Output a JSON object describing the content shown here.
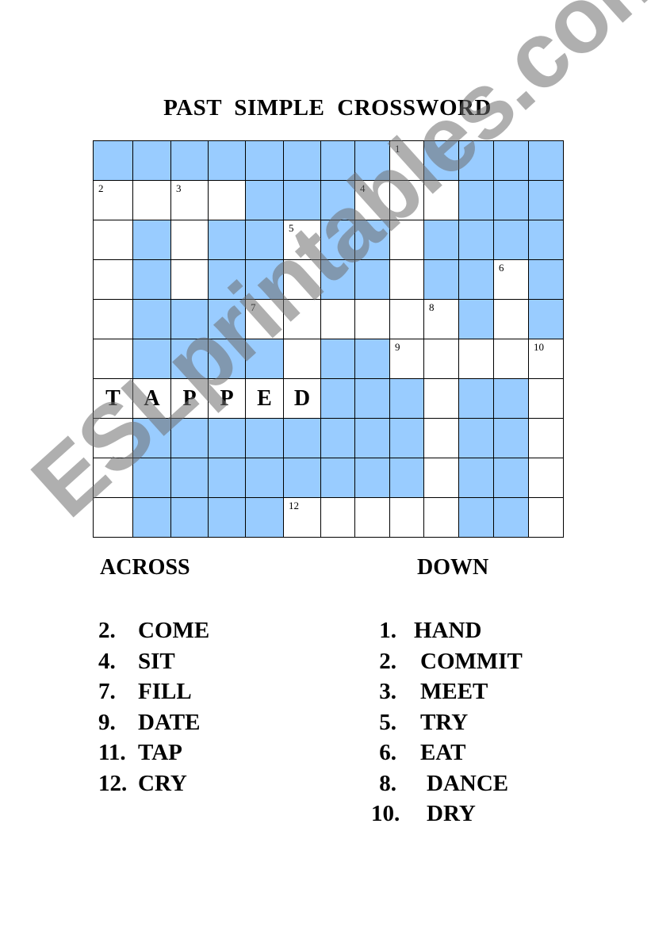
{
  "title": "PAST  SIMPLE  CROSSWORD",
  "grid": {
    "rows": [
      "BBBBBBBBWBBBB",
      "WWWWBBBWWWBBB",
      "WBWBBWBBWBBBB",
      "WBWBBWBBWBBWB",
      "WBBBWWWWWWBWB",
      "WBBBBWBBWWWWW",
      "WWWWWWBBBWBBW",
      "WBBBBBBBBWBBW",
      "WBBBBBBBBWBBW",
      "WBBBBWWWWWBBW"
    ],
    "numbers": [
      {
        "row": 0,
        "col": 8,
        "n": "1"
      },
      {
        "row": 1,
        "col": 0,
        "n": "2"
      },
      {
        "row": 1,
        "col": 2,
        "n": "3"
      },
      {
        "row": 1,
        "col": 7,
        "n": "4"
      },
      {
        "row": 2,
        "col": 5,
        "n": "5"
      },
      {
        "row": 3,
        "col": 11,
        "n": "6"
      },
      {
        "row": 4,
        "col": 4,
        "n": "7"
      },
      {
        "row": 4,
        "col": 9,
        "n": "8"
      },
      {
        "row": 5,
        "col": 8,
        "n": "9"
      },
      {
        "row": 5,
        "col": 12,
        "n": "10"
      },
      {
        "row": 9,
        "col": 5,
        "n": "12"
      }
    ],
    "filled": [
      {
        "row": 6,
        "col": 0,
        "letter": "T"
      },
      {
        "row": 6,
        "col": 1,
        "letter": "A"
      },
      {
        "row": 6,
        "col": 2,
        "letter": "P"
      },
      {
        "row": 6,
        "col": 3,
        "letter": "P"
      },
      {
        "row": 6,
        "col": 4,
        "letter": "E"
      },
      {
        "row": 6,
        "col": 5,
        "letter": "D"
      }
    ],
    "colors": {
      "blocked": "#99ccff",
      "open": "#ffffff",
      "line": "#000000"
    }
  },
  "across": {
    "heading": "ACROSS",
    "clues": [
      {
        "n": "2.",
        "word": "COME"
      },
      {
        "n": "4.",
        "word": "SIT"
      },
      {
        "n": "7.",
        "word": "FILL"
      },
      {
        "n": "9.",
        "word": "DATE"
      },
      {
        "n": "11.",
        "word": "TAP"
      },
      {
        "n": "12.",
        "word": "CRY"
      }
    ]
  },
  "down": {
    "heading": "DOWN",
    "clues": [
      {
        "n": "1.",
        "word": "HAND"
      },
      {
        "n": "2.",
        "word": "COMMIT"
      },
      {
        "n": "3.",
        "word": "MEET"
      },
      {
        "n": "5.",
        "word": "TRY"
      },
      {
        "n": "6.",
        "word": "EAT"
      },
      {
        "n": "8.",
        "word": "DANCE"
      },
      {
        "n": "10.",
        "word": "DRY"
      }
    ]
  },
  "watermark": "ESLprintables.com"
}
